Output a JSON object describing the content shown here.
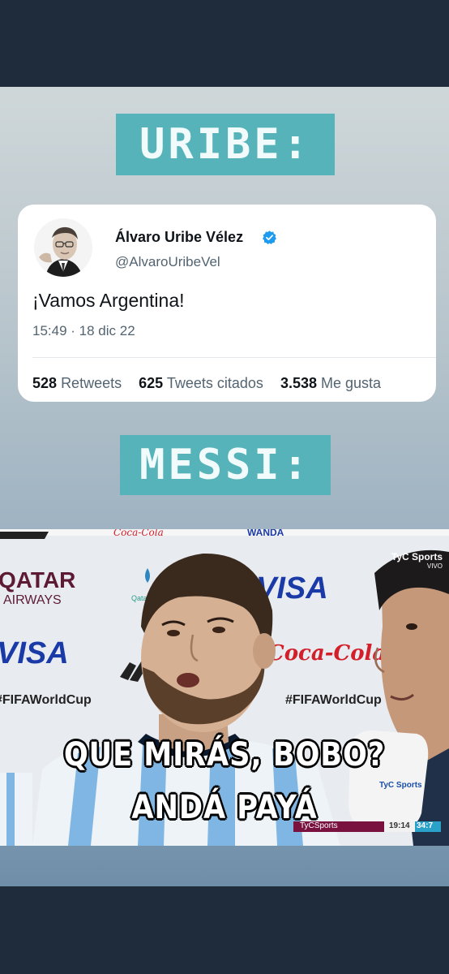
{
  "meme": {
    "label_top": "URIBE:",
    "label_bottom": "MESSI:",
    "label_color": "#56b3b9"
  },
  "tweet": {
    "author_name": "Álvaro Uribe Vélez",
    "handle": "@AlvaroUribeVel",
    "verified": true,
    "text": "¡Vamos Argentina!",
    "timestamp": "15:49 · 18 dic 22",
    "stats": [
      {
        "count": "528",
        "label": "Retweets"
      },
      {
        "count": "625",
        "label": "Tweets citados"
      },
      {
        "count": "3.538",
        "label": "Me gusta"
      }
    ]
  },
  "photo": {
    "caption_line1": "QUE MIRÁS, BOBO?",
    "caption_line2": "ANDÁ PAYÁ",
    "backdrop_sponsors": [
      "QATAR",
      "AIRWAYS",
      "VISA",
      "VISA",
      "#FIFAWorldCup",
      "#FIFAWorldCup",
      "Coca-Cola",
      "WANDA"
    ],
    "broadcaster": "TyC Sports",
    "broadcaster_sub": "VIVO",
    "ticker_channel": "TyCSports",
    "ticker_time": "19:14",
    "ticker_extra": "34:7"
  }
}
